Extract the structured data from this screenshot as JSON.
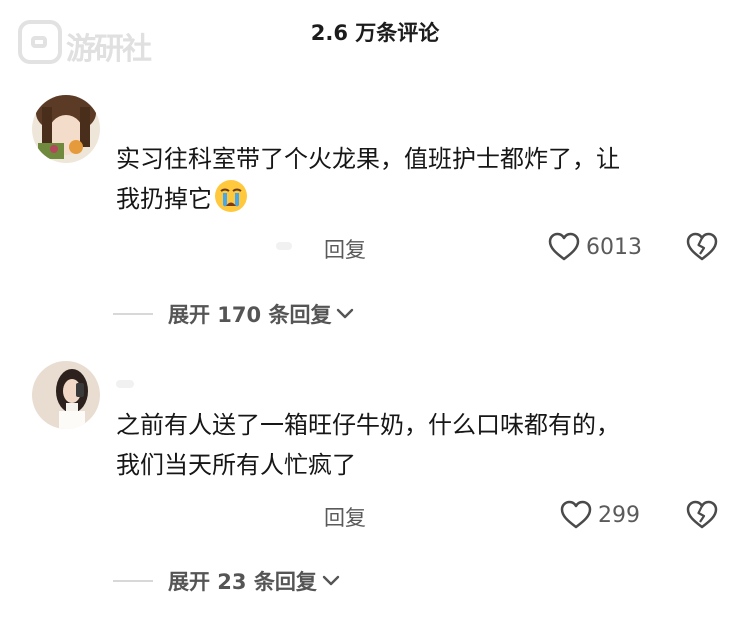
{
  "watermark": {
    "text": "游研社"
  },
  "header": {
    "title": "2.6 万条评论"
  },
  "comments": [
    {
      "text_line1": "实习往科室带了个火龙果，值班护士都炸了，让",
      "text_line2": "我扔掉它",
      "emoji": "crying-face-icon",
      "reply_label": "回复",
      "like_count": "6013",
      "expand_label": "展开 170 条回复"
    },
    {
      "text_line1": "之前有人送了一箱旺仔牛奶，什么口味都有的，",
      "text_line2": "我们当天所有人忙疯了",
      "reply_label": "回复",
      "like_count": "299",
      "expand_label": "展开 23 条回复"
    }
  ],
  "colors": {
    "text": "#161616",
    "muted": "#5a5a5a",
    "watermark": "#e0e0e0"
  }
}
